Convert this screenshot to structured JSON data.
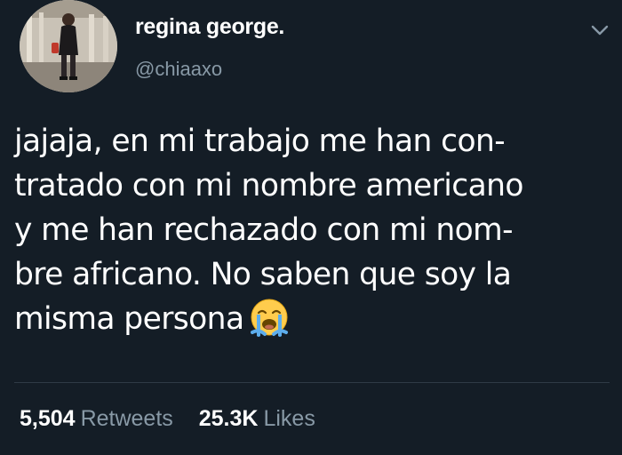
{
  "user": {
    "display_name": "regina george.",
    "handle": "@chiaaxo"
  },
  "tweet": {
    "lines": [
      "jajaja, en mi trabajo me han con-",
      "tratado con mi nombre americano",
      "y me han rechazado con mi nom-",
      "bre africano. No saben que soy la",
      "misma persona"
    ],
    "emoji": "loudly-crying-face"
  },
  "stats": {
    "retweets_count": "5,504",
    "retweets_label": "Retweets",
    "likes_count": "25.3K",
    "likes_label": "Likes"
  },
  "icons": {
    "menu": "chevron-down-icon",
    "avatar": "profile-photo"
  },
  "colors": {
    "background": "#141d26",
    "text": "#ffffff",
    "muted": "#8899a6"
  }
}
